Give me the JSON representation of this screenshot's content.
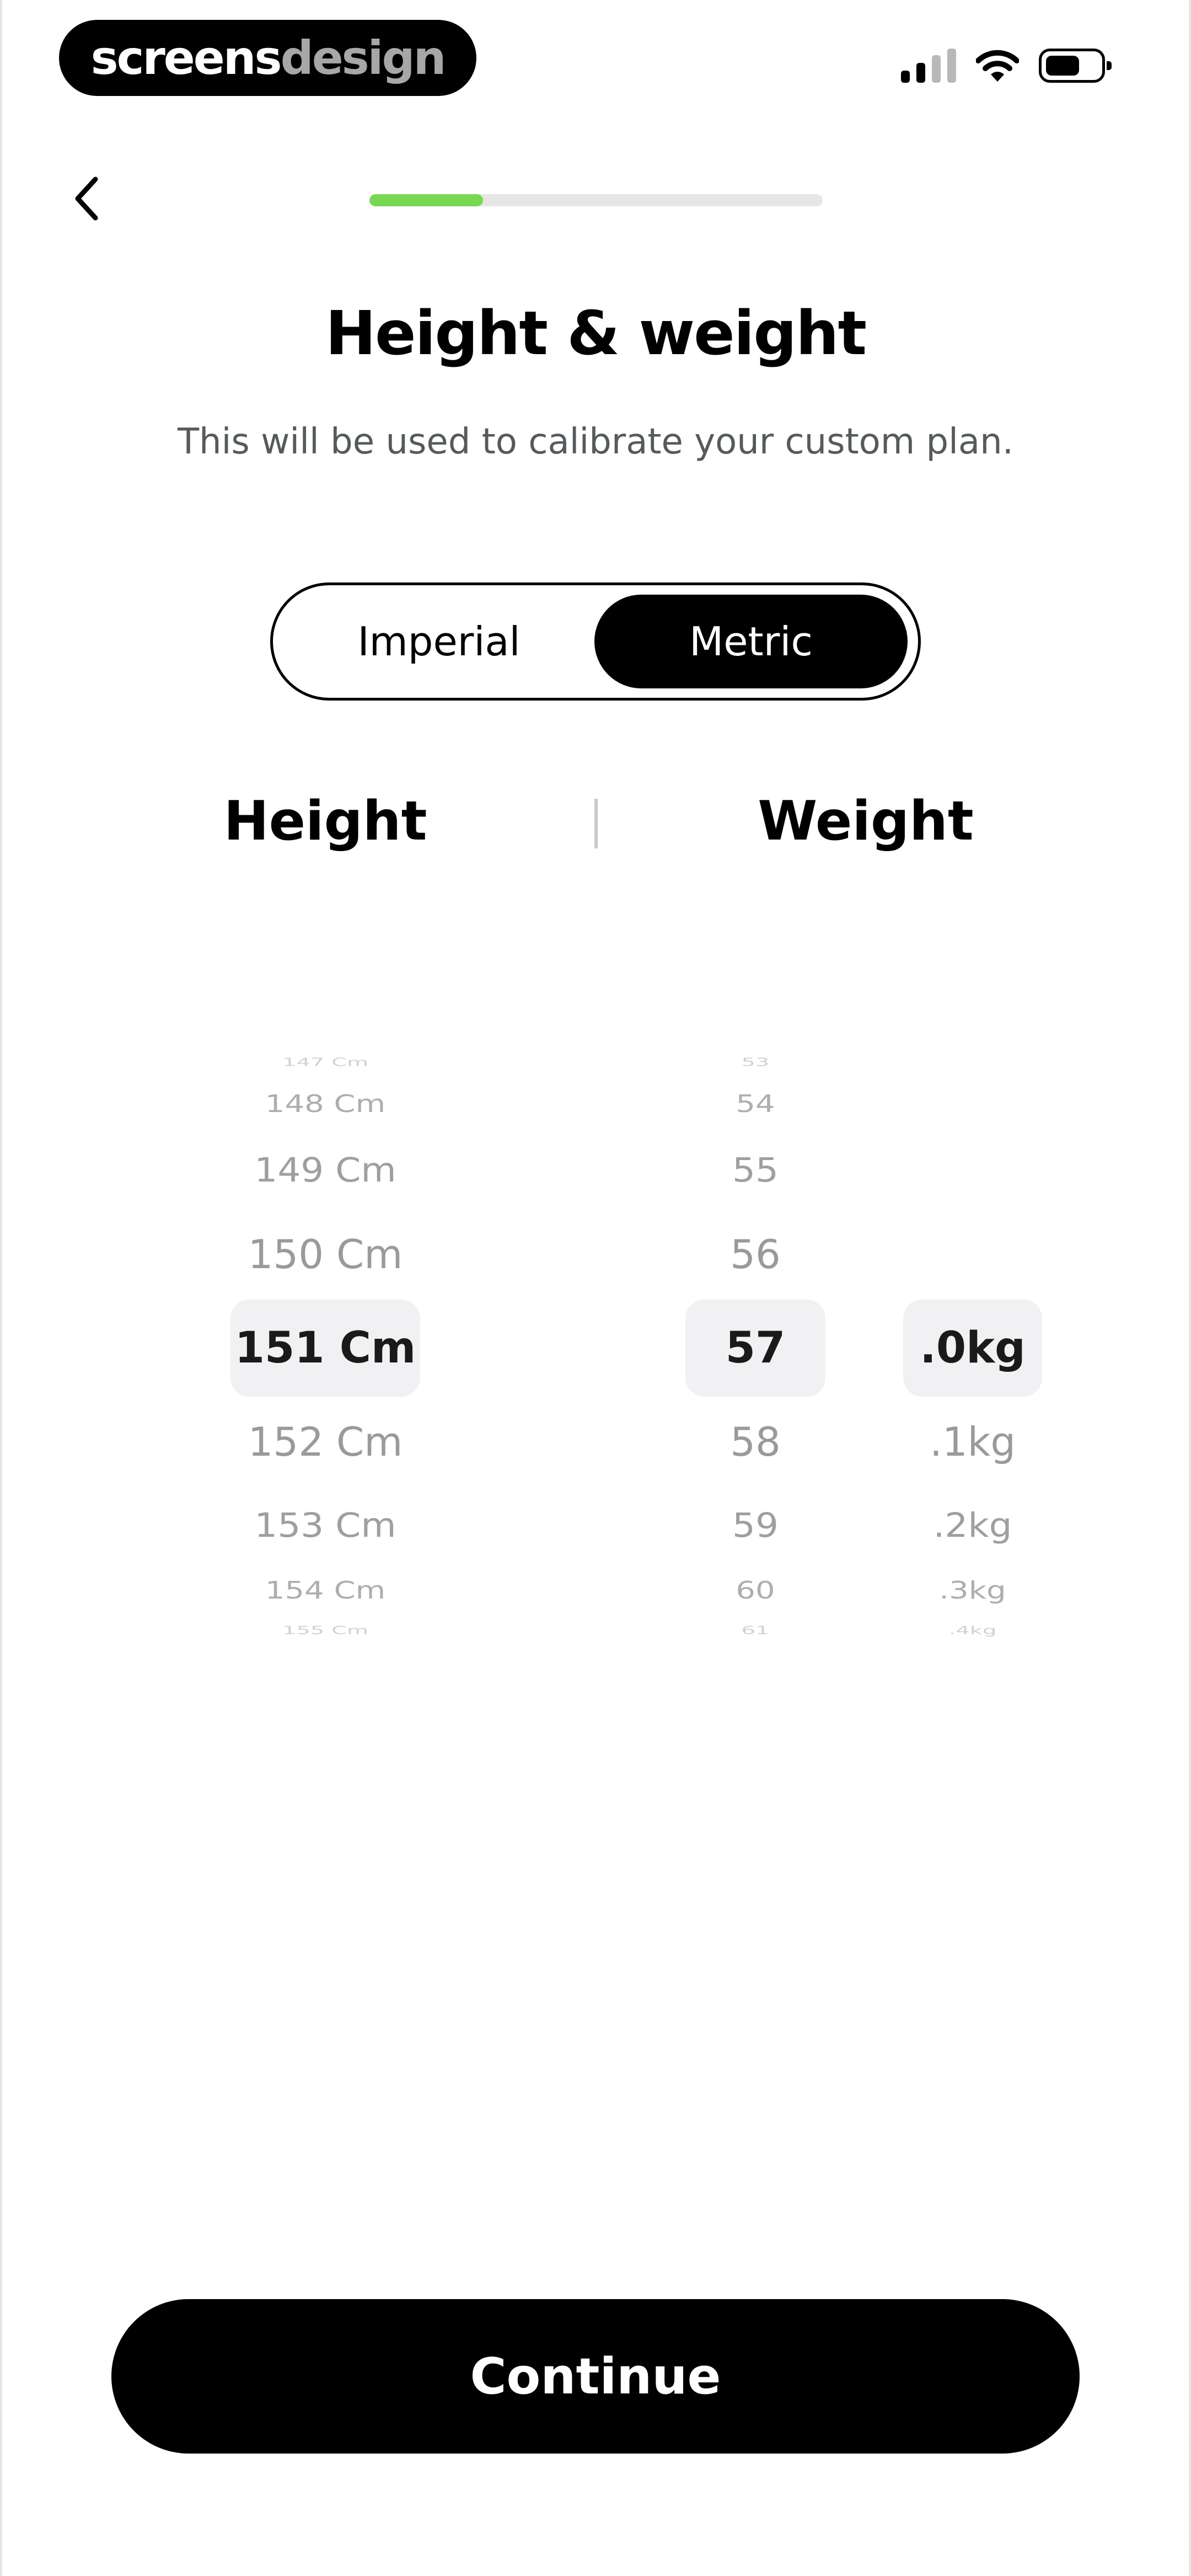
{
  "status_bar": {
    "brand_left": "screens",
    "brand_right": "design",
    "signal_icon": "cellular-signal-icon",
    "wifi_icon": "wifi-icon",
    "battery_icon": "battery-icon"
  },
  "nav": {
    "back_icon": "chevron-left-icon",
    "progress_fraction": 0.25,
    "progress_color": "#79d851"
  },
  "header": {
    "title": "Height & weight",
    "subtitle": "This will be used to calibrate your custom plan."
  },
  "units_toggle": {
    "options": [
      "Imperial",
      "Metric"
    ],
    "selected": "Metric"
  },
  "columns": {
    "height_label": "Height",
    "weight_label": "Weight"
  },
  "height_picker": {
    "items": [
      "147 Cm",
      "148 Cm",
      "149 Cm",
      "150 Cm",
      "151 Cm",
      "152 Cm",
      "153 Cm",
      "154 Cm",
      "155 Cm"
    ],
    "selected": "151 Cm"
  },
  "weight_whole_picker": {
    "items": [
      "53",
      "54",
      "55",
      "56",
      "57",
      "58",
      "59",
      "60",
      "61"
    ],
    "selected": "57"
  },
  "weight_decimal_picker": {
    "items": [
      ".0kg",
      ".1kg",
      ".2kg",
      ".3kg",
      ".4kg"
    ],
    "selected": ".0kg"
  },
  "footer": {
    "continue_label": "Continue"
  }
}
